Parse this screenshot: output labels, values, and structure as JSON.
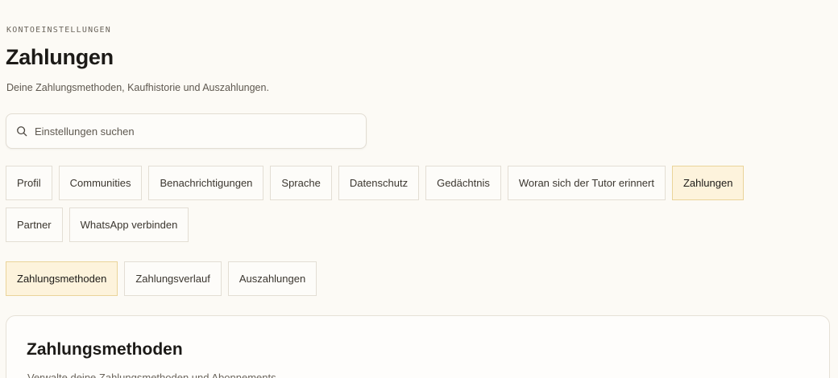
{
  "header": {
    "eyebrow": "KONTOEINSTELLUNGEN",
    "title": "Zahlungen",
    "subtitle": "Deine Zahlungsmethoden, Kaufhistorie und Auszahlungen."
  },
  "search": {
    "placeholder": "Einstellungen suchen",
    "icon": "search-icon"
  },
  "settings_tabs": [
    {
      "label": "Profil",
      "active": false
    },
    {
      "label": "Communities",
      "active": false
    },
    {
      "label": "Benachrichtigungen",
      "active": false
    },
    {
      "label": "Sprache",
      "active": false
    },
    {
      "label": "Datenschutz",
      "active": false
    },
    {
      "label": "Gedächtnis",
      "active": false
    },
    {
      "label": "Woran sich der Tutor erinnert",
      "active": false
    },
    {
      "label": "Zahlungen",
      "active": true
    },
    {
      "label": "Partner",
      "active": false
    },
    {
      "label": "WhatsApp verbinden",
      "active": false
    }
  ],
  "payment_tabs": [
    {
      "label": "Zahlungsmethoden",
      "active": true
    },
    {
      "label": "Zahlungsverlauf",
      "active": false
    },
    {
      "label": "Auszahlungen",
      "active": false
    }
  ],
  "card": {
    "title": "Zahlungsmethoden",
    "subtitle": "Verwalte deine Zahlungsmethoden und Abonnements."
  },
  "colors": {
    "background": "#fcfaf5",
    "active_chip": "#fdf3dc",
    "active_border": "#ead49a"
  }
}
